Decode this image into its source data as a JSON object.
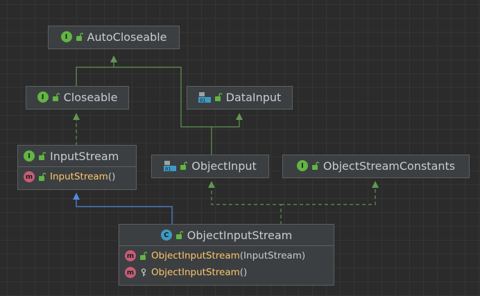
{
  "nodes": {
    "autocloseable": {
      "name": "AutoCloseable",
      "kind": "I"
    },
    "closeable": {
      "name": "Closeable",
      "kind": "I"
    },
    "datainput": {
      "name": "DataInput",
      "kind": "I",
      "icon_text": "01"
    },
    "inputstream": {
      "name": "InputStream",
      "kind": "I",
      "members": [
        {
          "badge": "m",
          "name": "InputStream",
          "params": "()"
        }
      ]
    },
    "objectinput": {
      "name": "ObjectInput",
      "kind": "I",
      "icon_text": "01"
    },
    "objectstreamconstants": {
      "name": "ObjectStreamConstants",
      "kind": "I"
    },
    "objectinputstream": {
      "name": "ObjectInputStream",
      "kind": "C",
      "members": [
        {
          "badge": "m",
          "name": "ObjectInputStream",
          "params": "(InputStream)"
        },
        {
          "badge": "m",
          "name": "ObjectInputStream",
          "params": "()"
        }
      ]
    }
  },
  "colors": {
    "background": "#2b2b2b",
    "node_bg": "#3c3f41",
    "node_border": "#5e6060",
    "interface_badge": "#62b543",
    "class_badge": "#3d9bc3",
    "method_badge": "#c75d77",
    "extends_edge": "#629755",
    "class_extends_edge": "#5589e0",
    "method_name": "#ffc66d",
    "text": "#c9cdd1"
  },
  "icons": {
    "interface": "interface-badge-icon",
    "class": "class-badge-icon",
    "method": "method-badge-icon",
    "public": "unlock-icon",
    "package_private": "key-icon",
    "data_interface": "data-interface-icon"
  }
}
